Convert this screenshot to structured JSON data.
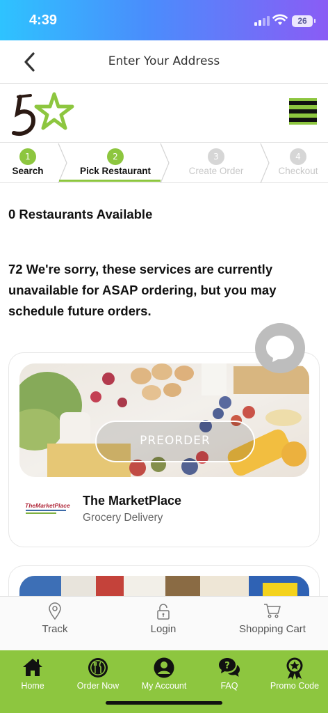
{
  "status_bar": {
    "time": "4:39",
    "battery": "26"
  },
  "header": {
    "title": "Enter Your Address"
  },
  "stepper": {
    "steps": [
      {
        "num": "1",
        "label": "Search"
      },
      {
        "num": "2",
        "label": "Pick Restaurant"
      },
      {
        "num": "3",
        "label": "Create Order"
      },
      {
        "num": "4",
        "label": "Checkout"
      }
    ]
  },
  "main": {
    "available_count": "0 Restaurants Available",
    "message": "72 We're sorry, these services are currently unavailable for ASAP ordering, but you may schedule future orders."
  },
  "restaurants": [
    {
      "name": "The MarketPlace",
      "type": "Grocery Delivery",
      "action_label": "PREORDER"
    }
  ],
  "sub_nav": {
    "items": [
      {
        "label": "Track",
        "icon": "location-pin-icon"
      },
      {
        "label": "Login",
        "icon": "unlock-icon"
      },
      {
        "label": "Shopping Cart",
        "icon": "cart-icon"
      }
    ]
  },
  "bottom_nav": {
    "items": [
      {
        "label": "Home",
        "icon": "home-icon"
      },
      {
        "label": "Order Now",
        "icon": "plate-cutlery-icon"
      },
      {
        "label": "My Account",
        "icon": "user-icon"
      },
      {
        "label": "FAQ",
        "icon": "chat-question-icon"
      },
      {
        "label": "Promo Code",
        "icon": "badge-star-icon"
      }
    ]
  },
  "colors": {
    "brand_green": "#8dc63f",
    "status_gradient_start": "#2ec3ff",
    "status_gradient_end": "#8a5cf5"
  }
}
